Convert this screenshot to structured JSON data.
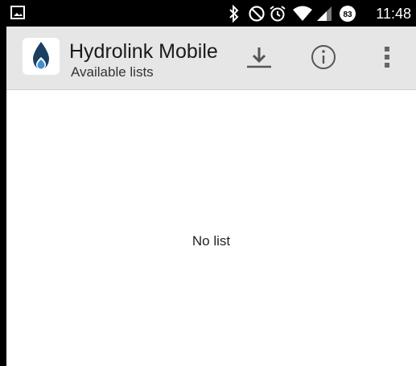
{
  "status_bar": {
    "time": "11:48",
    "battery_level": "83",
    "icons": [
      "image-notification-icon",
      "bluetooth-icon",
      "do-not-disturb-icon",
      "alarm-icon",
      "wifi-icon",
      "signal-icon",
      "battery-icon"
    ]
  },
  "action_bar": {
    "title": "Hydrolink Mobile",
    "subtitle": "Available lists",
    "actions": [
      "download-icon",
      "info-icon",
      "overflow-menu-icon"
    ],
    "background": "#e6e6e6"
  },
  "content": {
    "empty_message": "No list"
  }
}
